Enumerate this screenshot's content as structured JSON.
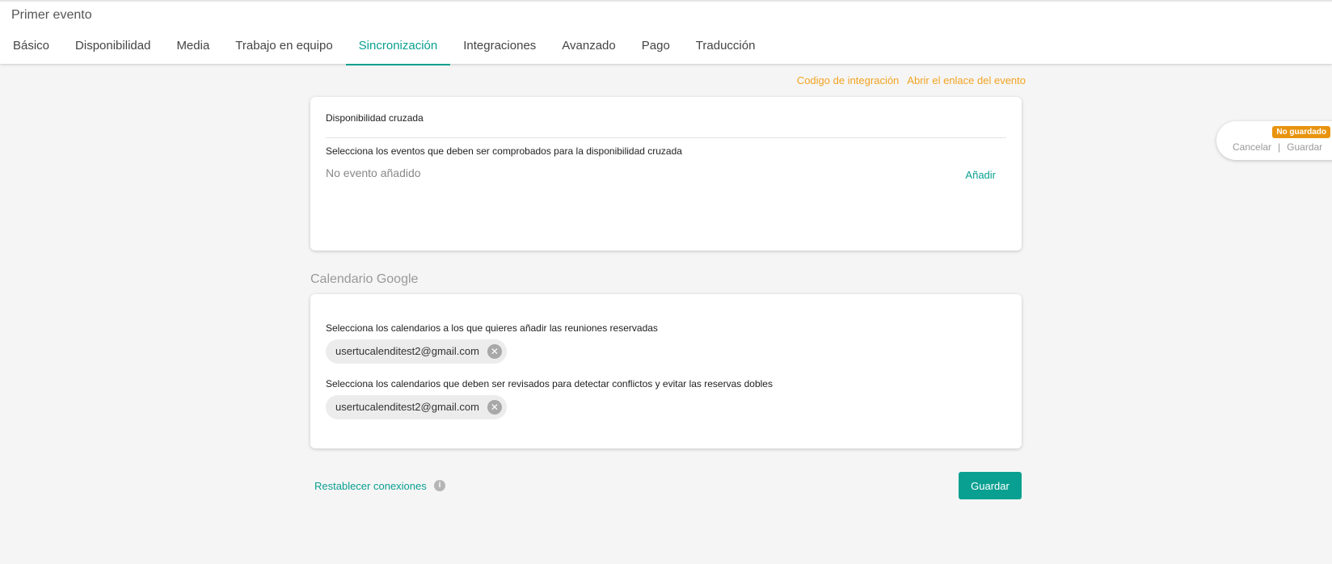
{
  "header": {
    "event_title": "Primer evento",
    "tabs": [
      {
        "label": "Básico",
        "active": false
      },
      {
        "label": "Disponibilidad",
        "active": false
      },
      {
        "label": "Media",
        "active": false
      },
      {
        "label": "Trabajo en equipo",
        "active": false
      },
      {
        "label": "Sincronización",
        "active": true
      },
      {
        "label": "Integraciones",
        "active": false
      },
      {
        "label": "Avanzado",
        "active": false
      },
      {
        "label": "Pago",
        "active": false
      },
      {
        "label": "Traducción",
        "active": false
      }
    ]
  },
  "top_links": {
    "integration_code": "Codigo de integración",
    "open_event_link": "Abrir el enlace del evento"
  },
  "cross_availability": {
    "title": "Disponibilidad cruzada",
    "label": "Selecciona los eventos que deben ser comprobados para la disponibilidad cruzada",
    "empty_text": "No evento añadido",
    "add_label": "Añadir"
  },
  "google_calendar": {
    "section_title": "Calendario Google",
    "add_to_label": "Selecciona los calendarios a los que quieres añadir las reuniones reservadas",
    "add_to_calendars": [
      "usertucalenditest2@gmail.com"
    ],
    "conflict_label": "Selecciona los calendarios que deben ser revisados para detectar conflictos y evitar las reservas dobles",
    "conflict_calendars": [
      "usertucalenditest2@gmail.com"
    ]
  },
  "footer": {
    "reset_label": "Restablecer conexiones",
    "save_label": "Guardar"
  },
  "float_panel": {
    "badge": "No guardado",
    "cancel_label": "Cancelar",
    "separator": "|",
    "save_label": "Guardar"
  },
  "colors": {
    "accent": "#0aa091",
    "link_orange": "#f3a321",
    "badge_orange": "#e8940f"
  }
}
